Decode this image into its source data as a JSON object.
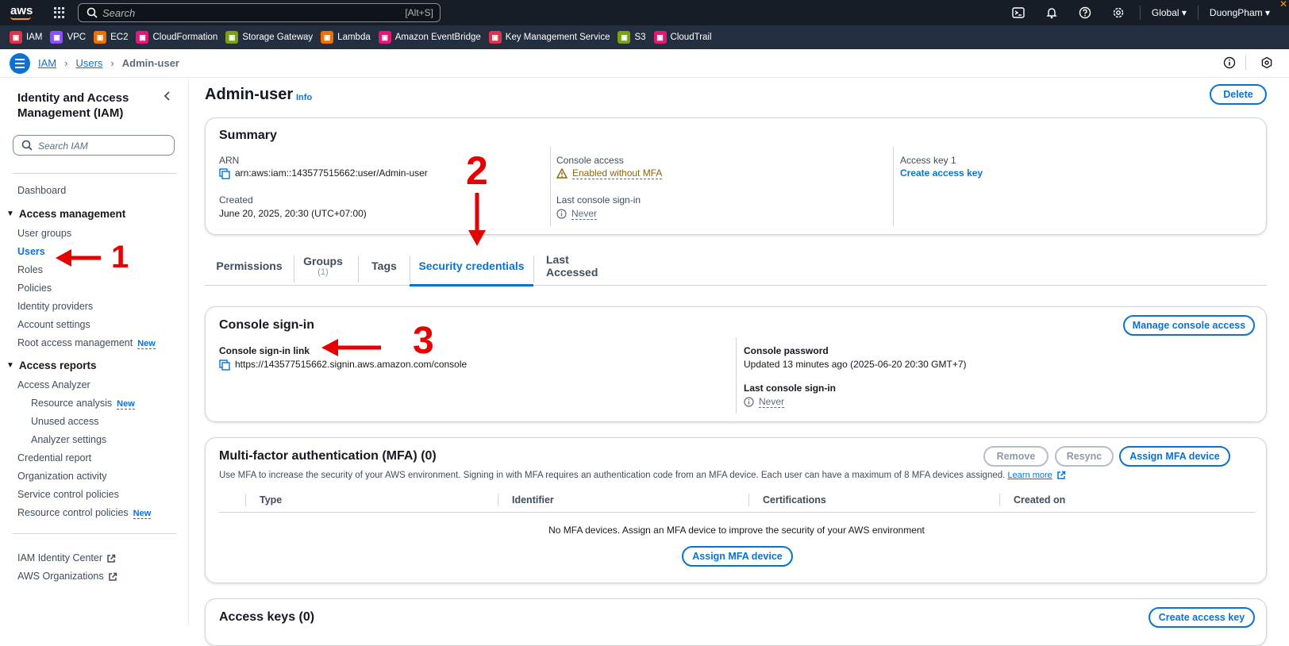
{
  "topnav": {
    "logo": "aws",
    "search_placeholder": "Search",
    "search_shortcut": "[Alt+S]",
    "region": "Global ▾",
    "account": "DuongPham ▾",
    "icons": [
      "cloudshell-icon",
      "bell-icon",
      "help-icon",
      "gear-icon"
    ]
  },
  "favorites": [
    {
      "label": "IAM",
      "color": "#dd344c"
    },
    {
      "label": "VPC",
      "color": "#8c4fff"
    },
    {
      "label": "EC2",
      "color": "#ed7100"
    },
    {
      "label": "CloudFormation",
      "color": "#e7157b"
    },
    {
      "label": "Storage Gateway",
      "color": "#7aa116"
    },
    {
      "label": "Lambda",
      "color": "#ed7100"
    },
    {
      "label": "Amazon EventBridge",
      "color": "#e7157b"
    },
    {
      "label": "Key Management Service",
      "color": "#dd344c"
    },
    {
      "label": "S3",
      "color": "#7aa116"
    },
    {
      "label": "CloudTrail",
      "color": "#e7157b"
    }
  ],
  "breadcrumb": {
    "root": "IAM",
    "level1": "Users",
    "current": "Admin-user"
  },
  "sidebar": {
    "title": "Identity and Access Management (IAM)",
    "search_placeholder": "Search IAM",
    "dashboard": "Dashboard",
    "access_management": "Access management",
    "user_groups": "User groups",
    "users": "Users",
    "roles": "Roles",
    "policies": "Policies",
    "identity_providers": "Identity providers",
    "account_settings": "Account settings",
    "root_access": "Root access management",
    "new_badge": "New",
    "access_reports": "Access reports",
    "access_analyzer": "Access Analyzer",
    "resource_analysis": "Resource analysis",
    "unused_access": "Unused access",
    "analyzer_settings": "Analyzer settings",
    "credential_report": "Credential report",
    "organization_activity": "Organization activity",
    "service_control_policies": "Service control policies",
    "resource_control_policies": "Resource control policies",
    "identity_center": "IAM Identity Center",
    "organizations": "AWS Organizations"
  },
  "page": {
    "title": "Admin-user",
    "info": "Info",
    "delete": "Delete"
  },
  "summary": {
    "title": "Summary",
    "arn_label": "ARN",
    "arn_value": "arn:aws:iam::143577515662:user/Admin-user",
    "created_label": "Created",
    "created_value": "June 20, 2025, 20:30 (UTC+07:00)",
    "console_access_label": "Console access",
    "console_access_value": "Enabled without MFA",
    "last_signin_label": "Last console sign-in",
    "last_signin_value": "Never",
    "access_key_label": "Access key 1",
    "access_key_value": "Create access key"
  },
  "tabs": [
    {
      "label": "Permissions"
    },
    {
      "label": "Groups",
      "count": "(1)"
    },
    {
      "label": "Tags"
    },
    {
      "label": "Security credentials"
    },
    {
      "label": "Last Accessed"
    }
  ],
  "console_signin": {
    "title": "Console sign-in",
    "manage_button": "Manage console access",
    "link_label": "Console sign-in link",
    "link_value": "https://143577515662.signin.aws.amazon.com/console",
    "password_label": "Console password",
    "password_value": "Updated 13 minutes ago (2025-06-20 20:30 GMT+7)",
    "last_signin_label": "Last console sign-in",
    "last_signin_value": "Never"
  },
  "mfa": {
    "title": "Multi-factor authentication (MFA) (0)",
    "remove": "Remove",
    "resync": "Resync",
    "assign": "Assign MFA device",
    "description": "Use MFA to increase the security of your AWS environment. Signing in with MFA requires an authentication code from an MFA device. Each user can have a maximum of 8 MFA devices assigned.",
    "learn_more": "Learn more",
    "columns": [
      "Type",
      "Identifier",
      "Certifications",
      "Created on"
    ],
    "empty_text": "No MFA devices. Assign an MFA device to improve the security of your AWS environment",
    "assign_center": "Assign MFA device"
  },
  "access_keys": {
    "title": "Access keys (0)",
    "create": "Create access key"
  },
  "annotations": {
    "one": "1",
    "two": "2",
    "three": "3"
  }
}
